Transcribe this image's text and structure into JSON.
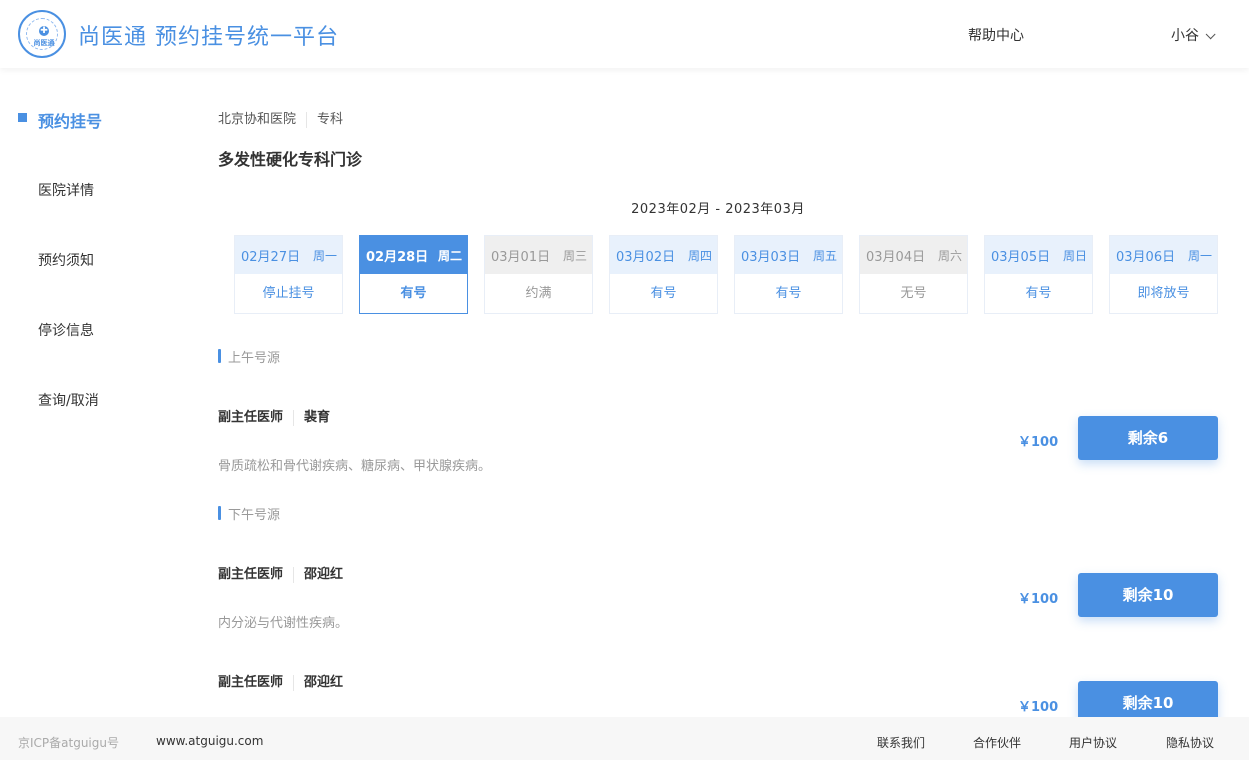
{
  "header": {
    "brand": "尚医通 预约挂号统一平台",
    "logo_text": "尚医通",
    "help": "帮助中心",
    "user": "小谷"
  },
  "sidebar": {
    "items": [
      {
        "label": "预约挂号",
        "active": true
      },
      {
        "label": "医院详情"
      },
      {
        "label": "预约须知"
      },
      {
        "label": "停诊信息"
      },
      {
        "label": "查询/取消"
      }
    ]
  },
  "breadcrumb": {
    "hospital": "北京协和医院",
    "category": "专科"
  },
  "department": "多发性硬化专科门诊",
  "month_range": "2023年02月 - 2023年03月",
  "dates": [
    {
      "date": "02月27日",
      "weekday": "周一",
      "status": "停止挂号",
      "state": "normal"
    },
    {
      "date": "02月28日",
      "weekday": "周二",
      "status": "有号",
      "state": "selected"
    },
    {
      "date": "03月01日",
      "weekday": "周三",
      "status": "约满",
      "state": "gray"
    },
    {
      "date": "03月02日",
      "weekday": "周四",
      "status": "有号",
      "state": "normal"
    },
    {
      "date": "03月03日",
      "weekday": "周五",
      "status": "有号",
      "state": "normal"
    },
    {
      "date": "03月04日",
      "weekday": "周六",
      "status": "无号",
      "state": "gray"
    },
    {
      "date": "03月05日",
      "weekday": "周日",
      "status": "有号",
      "state": "normal"
    },
    {
      "date": "03月06日",
      "weekday": "周一",
      "status": "即将放号",
      "state": "normal"
    }
  ],
  "morning": {
    "label": "上午号源",
    "doctors": [
      {
        "title": "副主任医师",
        "name": "裴育",
        "desc": "骨质疏松和骨代谢疾病、糖尿病、甲状腺疾病。",
        "price": "￥100",
        "button": "剩余6"
      }
    ]
  },
  "afternoon": {
    "label": "下午号源",
    "doctors": [
      {
        "title": "副主任医师",
        "name": "邵迎红",
        "desc": "内分泌与代谢性疾病。",
        "price": "￥100",
        "button": "剩余10"
      },
      {
        "title": "副主任医师",
        "name": "邵迎红",
        "desc": "",
        "price": "￥100",
        "button": "剩余10"
      }
    ]
  },
  "footer": {
    "icp": "京ICP备atguigu号",
    "site": "www.atguigu.com",
    "links": [
      "联系我们",
      "合作伙伴",
      "用户协议",
      "隐私协议"
    ]
  },
  "colors": {
    "accent": "#4a90e2",
    "light_accent": "#e8f1fc",
    "gray": "#efefef"
  }
}
